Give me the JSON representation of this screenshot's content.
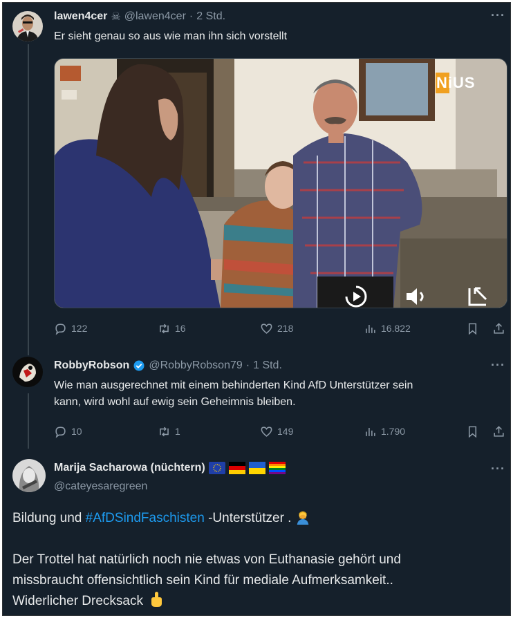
{
  "tweets": [
    {
      "display_name": "lawen4cer",
      "name_emoji": "☠",
      "handle": "@lawen4cer",
      "time": "2 Std.",
      "text": "Er sieht genau so aus wie man ihn sich vorstellt",
      "media_logo": "NiUS",
      "stats": {
        "replies": "122",
        "retweets": "16",
        "likes": "218",
        "views": "16.822"
      }
    },
    {
      "display_name": "RobbyRobson",
      "handle": "@RobbyRobson79",
      "time": "1 Std.",
      "text_line1": "Wie man ausgerechnet mit einem behinderten Kind AfD Unterstützer sein",
      "text_line2": "kann, wird wohl auf ewig sein Geheimnis bleiben.",
      "stats": {
        "replies": "10",
        "retweets": "1",
        "likes": "149",
        "views": "1.790"
      }
    },
    {
      "display_name": "Marija Sacharowa (nüchtern)",
      "handle": "@cateyesaregreen",
      "text_a_prefix": "Bildung und ",
      "text_a_hashtag": "#AfDSindFaschisten",
      "text_a_suffix": " -Unterstützer .",
      "text_b_line1": "Der Trottel hat natürlich noch nie etwas von Euthanasie gehört und",
      "text_b_line2": "missbraucht offensichtlich sein Kind für mediale Aufmerksamkeit..",
      "text_b_line3": "Widerlicher Drecksack"
    }
  ],
  "colors": {
    "background": "#15202b",
    "text": "#e7e9ea",
    "muted": "#8b98a5",
    "link": "#1d9bf0",
    "verified": "#1d9bf0"
  },
  "icons": [
    "reply-icon",
    "retweet-icon",
    "like-icon",
    "views-icon",
    "bookmark-icon",
    "share-icon",
    "more-icon",
    "verified-badge-icon",
    "play-icon",
    "volume-icon",
    "fullscreen-icon"
  ]
}
